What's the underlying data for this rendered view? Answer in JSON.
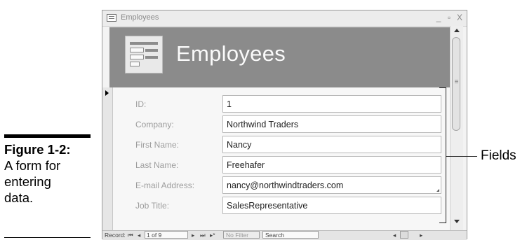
{
  "caption": {
    "figure_label": "Figure 1-2:",
    "lines": [
      "A form for",
      "entering",
      "data."
    ]
  },
  "callout": {
    "label": "Fields"
  },
  "window": {
    "title": "Employees",
    "controls": {
      "minimize": "_",
      "restore": "▫",
      "close": "X"
    }
  },
  "form": {
    "header_title": "Employees",
    "fields": [
      {
        "label": "ID:",
        "value": "1"
      },
      {
        "label": "Company:",
        "value": "Northwind Traders"
      },
      {
        "label": "First Name:",
        "value": "Nancy"
      },
      {
        "label": "Last Name:",
        "value": "Freehafer"
      },
      {
        "label": "E-mail Address:",
        "value": "nancy@northwindtraders.com"
      },
      {
        "label": "Job Title:",
        "value": "SalesRepresentative"
      }
    ]
  },
  "navigation": {
    "record_label": "Record:",
    "first": "⏮",
    "prev": "◂",
    "position": "1 of 9",
    "next": "▸",
    "last": "⏭",
    "new": "▸*",
    "filter_label": "No Filter",
    "search_label": "Search"
  }
}
